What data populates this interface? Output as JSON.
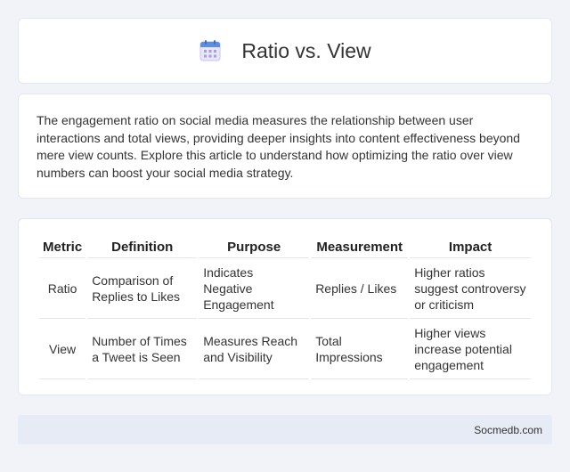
{
  "header": {
    "title": "Ratio vs. View",
    "icon": "calendar-icon"
  },
  "intro": {
    "text": "The engagement ratio on social media measures the relationship between user interactions and total views, providing deeper insights into content effectiveness beyond mere view counts. Explore this article to understand how optimizing the ratio over view numbers can boost your social media strategy."
  },
  "table": {
    "headers": [
      "Metric",
      "Definition",
      "Purpose",
      "Measurement",
      "Impact"
    ],
    "rows": [
      [
        "Ratio",
        "Comparison of Replies to Likes",
        "Indicates Negative Engagement",
        "Replies / Likes",
        "Higher ratios suggest controversy or criticism"
      ],
      [
        "View",
        "Number of Times a Tweet is Seen",
        "Measures Reach and Visibility",
        "Total Impressions",
        "Higher views increase potential engagement"
      ]
    ]
  },
  "footer": {
    "site": "Socmedb.com"
  },
  "colors": {
    "background": "#f1f3f9",
    "card": "#ffffff",
    "footer": "#e6ebf6"
  }
}
